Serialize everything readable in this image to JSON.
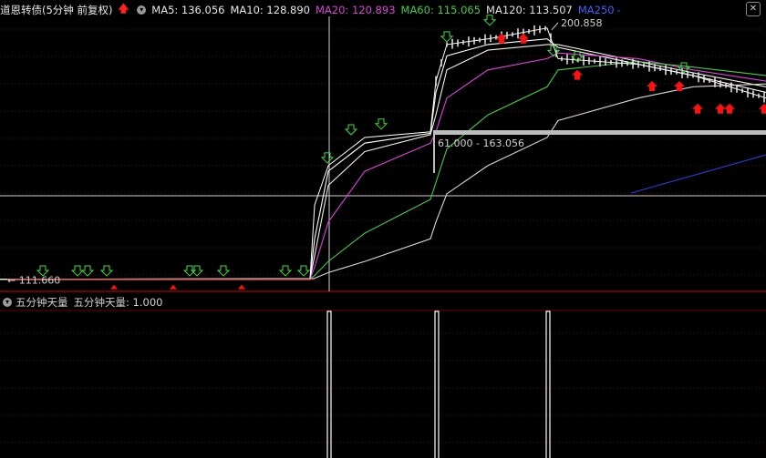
{
  "header": {
    "title": "道恩转债(5分钟 前复权)",
    "ma": [
      {
        "label": "MA5: 136.056",
        "color": "#e8e8e8"
      },
      {
        "label": "MA10: 128.890",
        "color": "#e8e8e8"
      },
      {
        "label": "MA20: 120.893",
        "color": "#e040e0"
      },
      {
        "label": "MA60: 115.065",
        "color": "#40d040"
      },
      {
        "label": "MA120: 113.507",
        "color": "#d8d8d8"
      },
      {
        "label": "MA250",
        "color": "#4060ff"
      }
    ],
    "ma250_suffix": "-"
  },
  "indicator": {
    "name": "五分钟天量",
    "value_label": "五分钟天量: 1.000"
  },
  "annotations": {
    "high_label": "200.858",
    "low_label": "111.660",
    "range_label": "61.000 - 163.056"
  },
  "chart_data": {
    "type": "line",
    "x_index": [
      0,
      340,
      345,
      360,
      400,
      472,
      478,
      490,
      535,
      600,
      612,
      700,
      760,
      840
    ],
    "price_close": [
      111.66,
      111.9,
      138,
      152,
      162,
      164,
      182,
      195,
      197,
      200.858,
      190,
      188,
      184,
      176
    ],
    "series": [
      {
        "name": "MA5",
        "color": "#ffffff",
        "values": [
          111.66,
          111.8,
          126,
          150,
          160,
          163.5,
          178,
          191,
          195,
          197,
          194,
          188,
          184,
          178
        ]
      },
      {
        "name": "MA10",
        "color": "#f0f0e0",
        "values": [
          111.66,
          111.7,
          120,
          145,
          157,
          163,
          170,
          186,
          193,
          195,
          195,
          189,
          185,
          180
        ]
      },
      {
        "name": "MA20",
        "color": "#e040e0",
        "values": [
          111.66,
          111.7,
          116,
          132,
          150,
          160,
          164,
          176,
          186,
          190,
          192,
          190,
          186,
          182
        ]
      },
      {
        "name": "MA60",
        "color": "#40d040",
        "values": [
          111.66,
          111.66,
          113,
          118,
          128,
          140,
          146,
          158,
          170,
          180,
          186,
          189,
          187,
          184
        ]
      },
      {
        "name": "MA120",
        "color": "#d8d8d8",
        "values": [
          111.66,
          111.66,
          112,
          114,
          118,
          126,
          132,
          142,
          152,
          162,
          168,
          176,
          180,
          181
        ]
      },
      {
        "name": "MA250",
        "color": "#2040e0",
        "values": [
          null,
          null,
          null,
          null,
          null,
          null,
          null,
          null,
          null,
          null,
          null,
          null,
          136,
          144
        ]
      }
    ],
    "signals_down_x": [
      47,
      85,
      96,
      117,
      208,
      216,
      245,
      313,
      333,
      359,
      385,
      418,
      490,
      537,
      607,
      633,
      750
    ],
    "signals_up_x": [
      550,
      574,
      633,
      715,
      745,
      765,
      790,
      800,
      838
    ],
    "signals_small_up_x": [
      125,
      190,
      265
    ],
    "volume_spikes_x": [
      361,
      479,
      601
    ],
    "ylim": [
      108,
      205
    ]
  }
}
